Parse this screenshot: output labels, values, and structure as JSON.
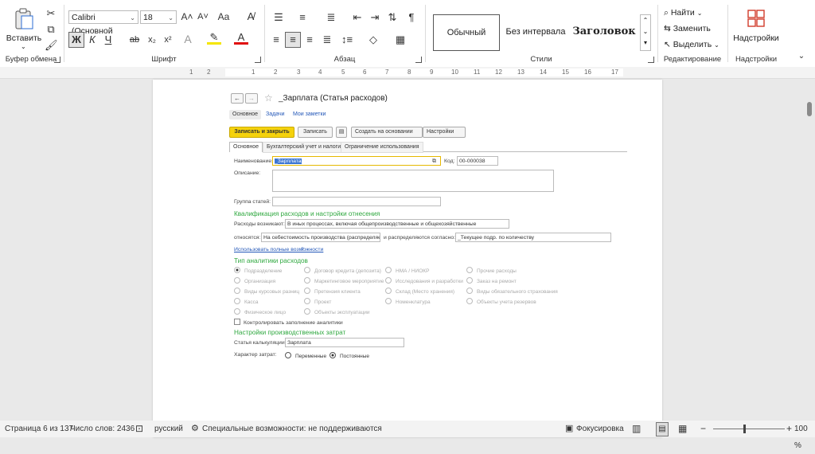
{
  "ribbon": {
    "clipboard": {
      "paste_label": "Вставить",
      "group_label": "Буфер обмена"
    },
    "font": {
      "family": "Calibri (Основной",
      "size": "18",
      "group_label": "Шрифт",
      "bold": "Ж",
      "italic": "К",
      "underline": "Ч",
      "strike": "ab",
      "sub": "x₂",
      "sup": "x²",
      "grow": "A˄",
      "shrink": "A˅",
      "case": "Aa",
      "highlight_color": "#f5e600",
      "font_color": "#e01010"
    },
    "paragraph": {
      "group_label": "Абзац"
    },
    "styles": {
      "group_label": "Стили",
      "items": [
        "Обычный",
        "Без интервала",
        "Заголовок"
      ]
    },
    "editing": {
      "group_label": "Редактирование",
      "find": "Найти",
      "replace": "Заменить",
      "select": "Выделить"
    },
    "addins": {
      "label": "Надстройки",
      "group_label": "Надстройки"
    }
  },
  "ruler": {
    "ticks": [
      "1",
      "2",
      "1",
      "2",
      "3",
      "4",
      "5",
      "6",
      "7",
      "8",
      "9",
      "10",
      "11",
      "12",
      "13",
      "14",
      "15",
      "16",
      "17"
    ]
  },
  "doc": {
    "title": "_Зарплата (Статья расходов)",
    "top_tabs": [
      "Основное",
      "Задачи",
      "Мои заметки"
    ],
    "toolbar": {
      "save_close": "Записать и закрыть",
      "save": "Записать",
      "create_based": "Создать на основании",
      "settings": "Настройки"
    },
    "form_tabs": [
      "Основное",
      "Бухгалтерский учет и налоги",
      "Ограничение использования"
    ],
    "name_label": "Наименование:",
    "name_value": "_Зарплата",
    "code_label": "Код:",
    "code_value": "00-000038",
    "desc_label": "Описание:",
    "group_label": "Группа статей:",
    "section1": "Квалификация расходов и настройки отнесения",
    "arise_label": "Расходы возникают:",
    "arise_value": "В иных процессах, включая общепроизводственные и общехозяйственные",
    "attr_label": "относятся:",
    "attr_value": "На себестоимость производства (распределяе",
    "distr_label": "и распределяются согласно:",
    "distr_value": "_Текущее подр. по количеству",
    "full_features": "Использовать полные возможности",
    "help": "?",
    "section2": "Тип аналитики расходов",
    "analytics": [
      [
        "Подразделение",
        "Договор кредита (депозита)",
        "НМА / НИОКР",
        "Прочие расходы"
      ],
      [
        "Организация",
        "Маркетинговое мероприятие",
        "Исследования и разработки",
        "Заказ на ремонт"
      ],
      [
        "Виды курсовых разниц",
        "Претензия клиента",
        "Склад (Место хранения)",
        "Виды обязательного страхования"
      ],
      [
        "Касса",
        "Проект",
        "Номенклатура",
        "Объекты учета резервов"
      ],
      [
        "Физическое лицо",
        "Объекты эксплуатации"
      ]
    ],
    "control_check": "Контролировать заполнение аналитики",
    "section3": "Настройки производственных затрат",
    "calc_label": "Статья калькуляции:",
    "calc_value": "Зарплата",
    "nature_label": "Характер затрат:",
    "nature_options": [
      "Переменные",
      "Постоянные"
    ]
  },
  "status": {
    "page": "Страница 6 из 137",
    "words": "Число слов: 2436",
    "lang": "русский",
    "accessibility": "Специальные возможности: не поддерживаются",
    "focus": "Фокусировка",
    "zoom_minus": "−",
    "zoom_plus": "+",
    "zoom": "100 %"
  }
}
